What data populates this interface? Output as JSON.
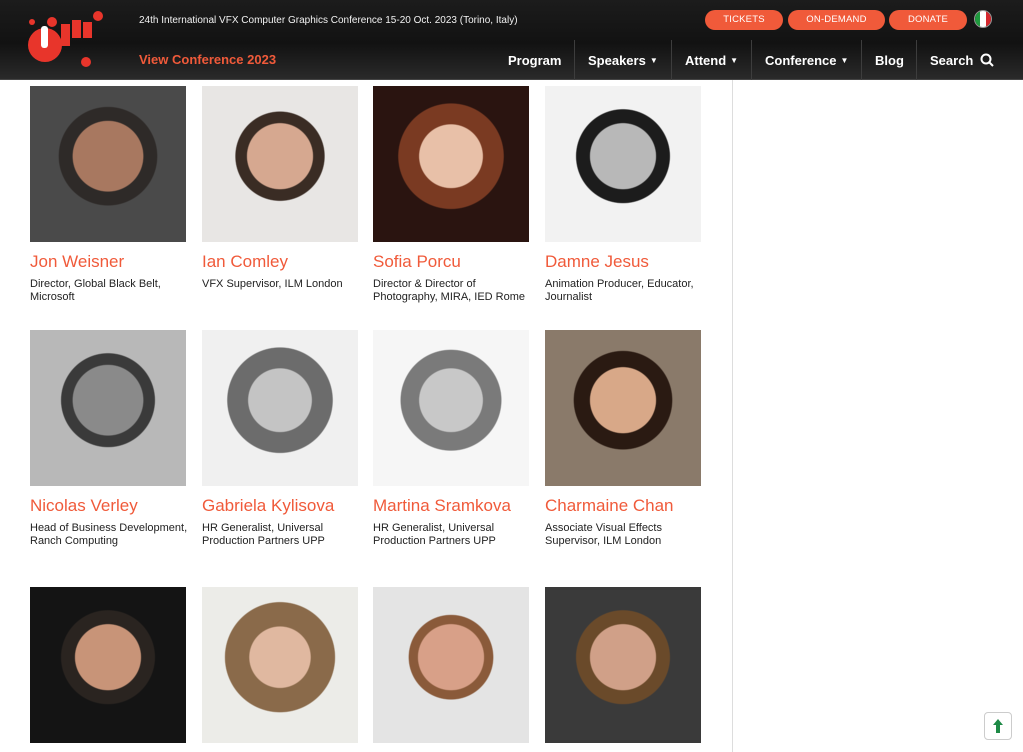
{
  "header": {
    "conference_line": "24th International VFX Computer Graphics Conference 15-20 Oct. 2023 (Torino, Italy)",
    "buttons": [
      "TICKETS",
      "ON-DEMAND",
      "DONATE"
    ],
    "view_conference": "View Conference 2023",
    "nav": [
      "Program",
      "Speakers",
      "Attend",
      "Conference",
      "Blog",
      "Search"
    ],
    "flag_colors": [
      "#1f9a3e",
      "#ffffff",
      "#d4272d"
    ]
  },
  "speakers": [
    {
      "name": "Jon Weisner",
      "role": "Director, Global Black Belt, Microsoft"
    },
    {
      "name": "Ian Comley",
      "role": "VFX Supervisor, ILM London"
    },
    {
      "name": "Sofia Porcu",
      "role": "Director & Director of Photography, MIRA, IED Rome"
    },
    {
      "name": "Damne Jesus",
      "role": "Animation Producer, Educator, Journalist"
    },
    {
      "name": "Nicolas Verley",
      "role": "Head of Business Development, Ranch Computing"
    },
    {
      "name": "Gabriela Kylisova",
      "role": "HR Generalist, Universal Production Partners UPP"
    },
    {
      "name": "Martina Sramkova",
      "role": "HR Generalist, Universal Production Partners UPP"
    },
    {
      "name": "Charmaine Chan",
      "role": "Associate Visual Effects Supervisor, ILM London"
    },
    {
      "name": "",
      "role": ""
    },
    {
      "name": "",
      "role": ""
    },
    {
      "name": "",
      "role": ""
    },
    {
      "name": "",
      "role": ""
    }
  ],
  "colors": {
    "accent": "#f05a3a",
    "header_bg": "#1a1a1a"
  }
}
